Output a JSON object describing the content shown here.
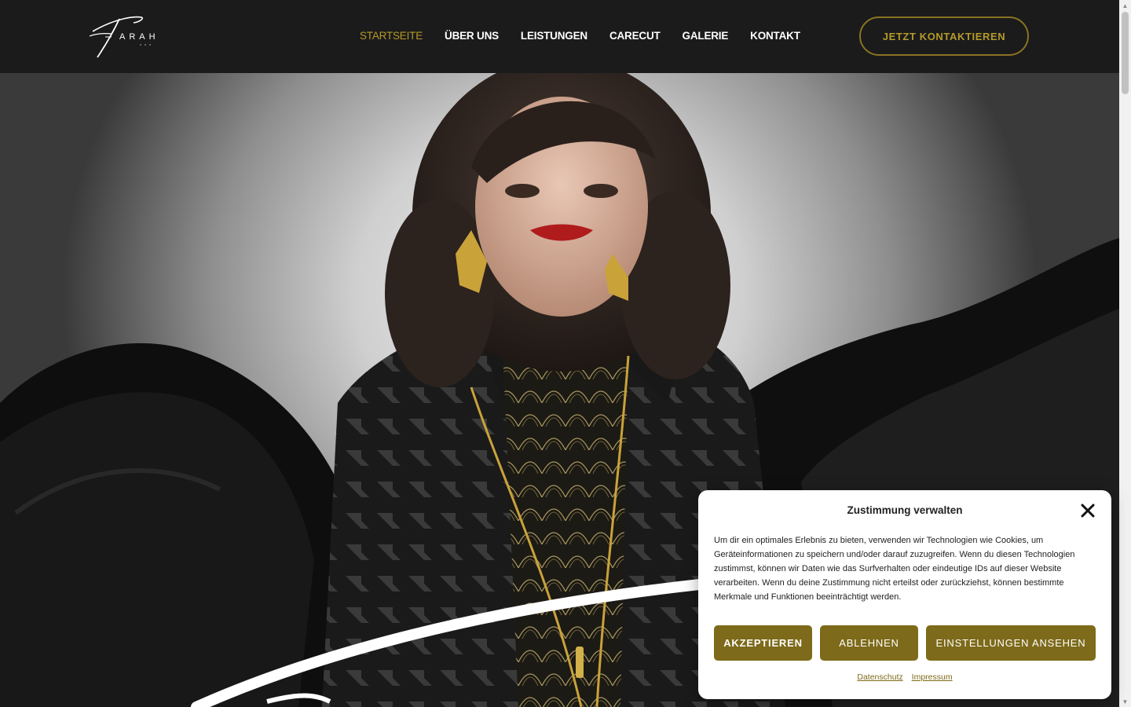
{
  "header": {
    "logo_text": "FARAH",
    "nav": [
      {
        "label": "STARTSEITE",
        "active": true
      },
      {
        "label": "ÜBER UNS",
        "active": false
      },
      {
        "label": "LEISTUNGEN",
        "active": false
      },
      {
        "label": "CARECUT",
        "active": false
      },
      {
        "label": "GALERIE",
        "active": false
      },
      {
        "label": "KONTAKT",
        "active": false
      }
    ],
    "cta_label": "JETZT KONTAKTIEREN"
  },
  "colors": {
    "background": "#1b1b1b",
    "accent": "#b59a2a",
    "button": "#7d6a1a",
    "dialog_bg": "#ffffff"
  },
  "hero": {
    "image": "woman-portrait-black-dress-gold-earrings"
  },
  "cookie_dialog": {
    "title": "Zustimmung verwalten",
    "close_icon": "close-icon",
    "text": "Um dir ein optimales Erlebnis zu bieten, verwenden wir Technologien wie Cookies, um Geräteinformationen zu speichern und/oder darauf zuzugreifen. Wenn du diesen Technologien zustimmst, können wir Daten wie das Surfverhalten oder eindeutige IDs auf dieser Website verarbeiten. Wenn du deine Zustimmung nicht erteilst oder zurückziehst, können bestimmte Merkmale und Funktionen beeinträchtigt werden.",
    "accept_label": "AKZEPTIEREN",
    "deny_label": "ABLEHNEN",
    "preferences_label": "EINSTELLUNGEN ANSEHEN",
    "links": [
      "Datenschutz",
      "Impressum"
    ]
  }
}
